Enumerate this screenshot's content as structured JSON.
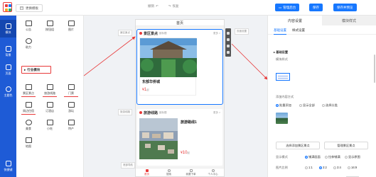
{
  "topbar": {
    "change_template": "更换模板",
    "undo": "撤销",
    "redo": "恢复",
    "manage_btn": "管理后台",
    "save_btn": "保存",
    "publish_btn": "保存并预览"
  },
  "leftnav": {
    "items": [
      {
        "label": "模块",
        "active": true
      },
      {
        "label": "背景",
        "active": false
      },
      {
        "label": "页面",
        "active": false
      },
      {
        "label": "主题色",
        "active": false
      },
      {
        "label": "快捷键",
        "active": false
      }
    ]
  },
  "components": {
    "top": [
      {
        "label": "公告",
        "icon": "megaphone-icon"
      },
      {
        "label": "按钮组",
        "icon": "button-group-icon"
      },
      {
        "label": "图片",
        "icon": "image-icon"
      },
      {
        "label": "助力",
        "icon": "boost-icon"
      }
    ],
    "section_title": "行业模块",
    "industry": [
      {
        "label": "景区景点",
        "icon": "attraction-icon"
      },
      {
        "label": "旅游线路",
        "icon": "route-icon"
      },
      {
        "label": "门票",
        "icon": "ticket-icon"
      },
      {
        "label": "周边住宿",
        "icon": "hotel-icon"
      },
      {
        "label": "订酒店",
        "icon": "bed-icon"
      },
      {
        "label": "游玩",
        "icon": "play-icon"
      },
      {
        "label": "美食",
        "icon": "food-icon"
      },
      {
        "label": "小吃",
        "icon": "snack-icon"
      },
      {
        "label": "特产",
        "icon": "specialty-icon"
      },
      {
        "label": "地图",
        "icon": "map-icon"
      }
    ]
  },
  "canvas": {
    "page_title": "首页",
    "side_labels": {
      "attraction": "景区景点",
      "route": "旅游线路",
      "bottom": "底部导航"
    },
    "right_side_label": "页面设置",
    "card1": {
      "title": "景区景点",
      "sub": "副标题",
      "more": "更多 >",
      "name": "东部华侨城",
      "price_symbol": "¥",
      "price": "1",
      "price_unit": "起"
    },
    "card2": {
      "title": "旅游线路",
      "sub": "副标题",
      "more": "更多 >",
      "name": "旅游路线1",
      "price_symbol": "¥",
      "price": "10",
      "price_unit": "起"
    },
    "tabbar": [
      {
        "label": "首页",
        "active": true
      },
      {
        "label": "搜索",
        "active": false
      },
      {
        "label": "我要下单",
        "active": false
      },
      {
        "label": "个人中心",
        "active": false
      }
    ]
  },
  "panel": {
    "tabs": [
      "内容设置",
      "模块样式"
    ],
    "subtabs": [
      "基础设置",
      "样式设置"
    ],
    "basic_header": "▸ 基础设置",
    "module_style": "模块样式",
    "add_method_label": "添加内容方式",
    "add_methods": [
      "批量添加",
      "显示全部",
      "选择分类"
    ],
    "add_selected": 0,
    "choose_btn": "选择添加景区景点",
    "manage_btn": "管理景区景点",
    "display_style_label": "显示模式",
    "display_styles": [
      "铺满画面",
      "拉伸铺满",
      "显示原图"
    ],
    "display_selected": 0,
    "ratio_label": "图片比例",
    "ratios": [
      "1:1",
      "3:2",
      "3:4",
      "16:9"
    ],
    "ratio_selected": 1,
    "corner_label": "圆角",
    "corners": [
      "直角",
      "圆角"
    ],
    "corner_selected": 1,
    "corner_value": "10",
    "corner_unit": "px"
  },
  "colors": {
    "accent": "#1677ff",
    "brand_red": "#e83a3a",
    "nav_blue": "#1e5bd6"
  }
}
